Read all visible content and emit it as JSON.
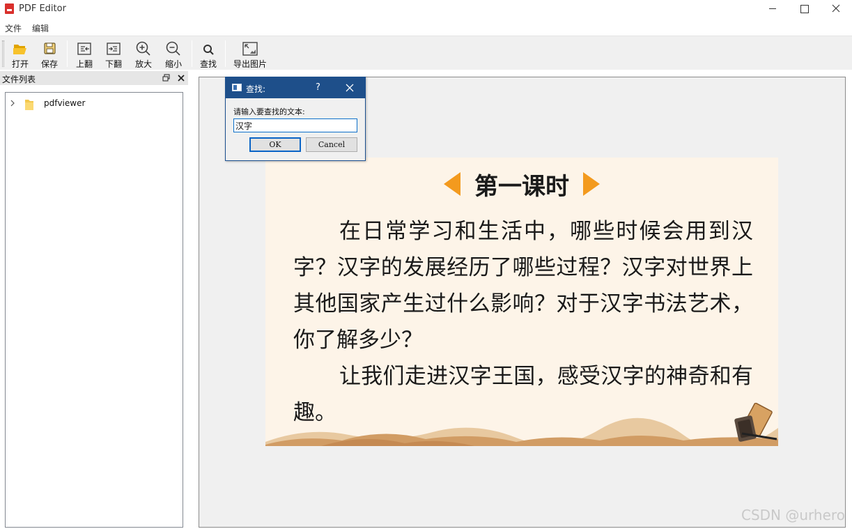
{
  "window": {
    "title": "PDF Editor"
  },
  "menu": [
    "文件",
    "编辑"
  ],
  "toolbar": {
    "open_label": "打开",
    "save_label": "保存",
    "prev_label": "上翻",
    "next_label": "下翻",
    "zoom_in_label": "放大",
    "zoom_out_label": "缩小",
    "find_label": "查找",
    "export_label": "导出图片"
  },
  "sidebar": {
    "title": "文件列表",
    "items": [
      {
        "label": "pdfviewer",
        "icon": "folder-icon",
        "expanded": false
      }
    ]
  },
  "document": {
    "title": "第一课时",
    "paragraphs": [
      "在日常学习和生活中，哪些时候会用到汉字？汉字的发展经历了哪些过程？汉字对世界上其他国家产生过什么影响？对于汉字书法艺术，你了解多少？",
      "让我们走进汉字王国，感受汉字的神奇和有趣。"
    ],
    "colors": {
      "page_bg": "#fdf4e8",
      "arrow": "#f39a1e"
    }
  },
  "find_dialog": {
    "title": "查找:",
    "help": "?",
    "prompt": "请输入要查找的文本:",
    "value": "汉字",
    "ok_label": "OK",
    "cancel_label": "Cancel"
  },
  "watermark": "CSDN @urhero"
}
